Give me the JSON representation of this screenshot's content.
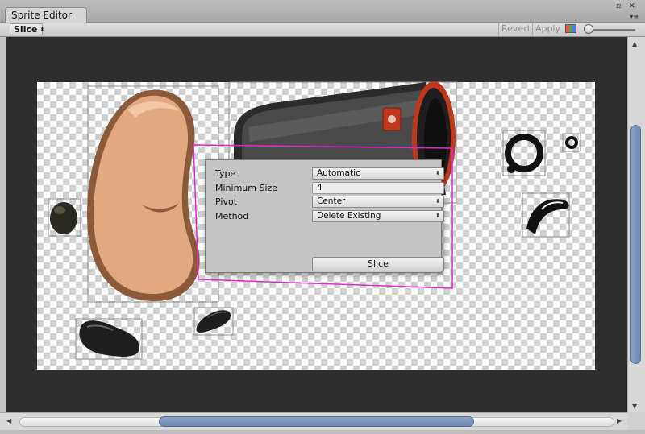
{
  "window": {
    "tab_title": "Sprite Editor",
    "controls": {
      "maximize": "▫",
      "close": "✕",
      "menu": "▾≡"
    }
  },
  "toolbar": {
    "slice_dropdown": "Slice",
    "revert_label": "Revert",
    "apply_label": "Apply"
  },
  "slice_panel": {
    "type_label": "Type",
    "type_value": "Automatic",
    "min_size_label": "Minimum Size",
    "min_size_value": "4",
    "pivot_label": "Pivot",
    "pivot_value": "Center",
    "method_label": "Method",
    "method_value": "Delete Existing",
    "slice_button": "Slice"
  },
  "colors": {
    "slice_outline": "#e02ad0",
    "sprite_bounds": "#8c8c8c",
    "canvas_background": "#2e2e2e",
    "scroll_thumb": "#7a93b9"
  },
  "icons": {
    "dropdown_arrow": "up-down-arrow-icon",
    "color_channel": "rgb-channels-icon",
    "zoom_slider": "zoom-slider-icon"
  }
}
